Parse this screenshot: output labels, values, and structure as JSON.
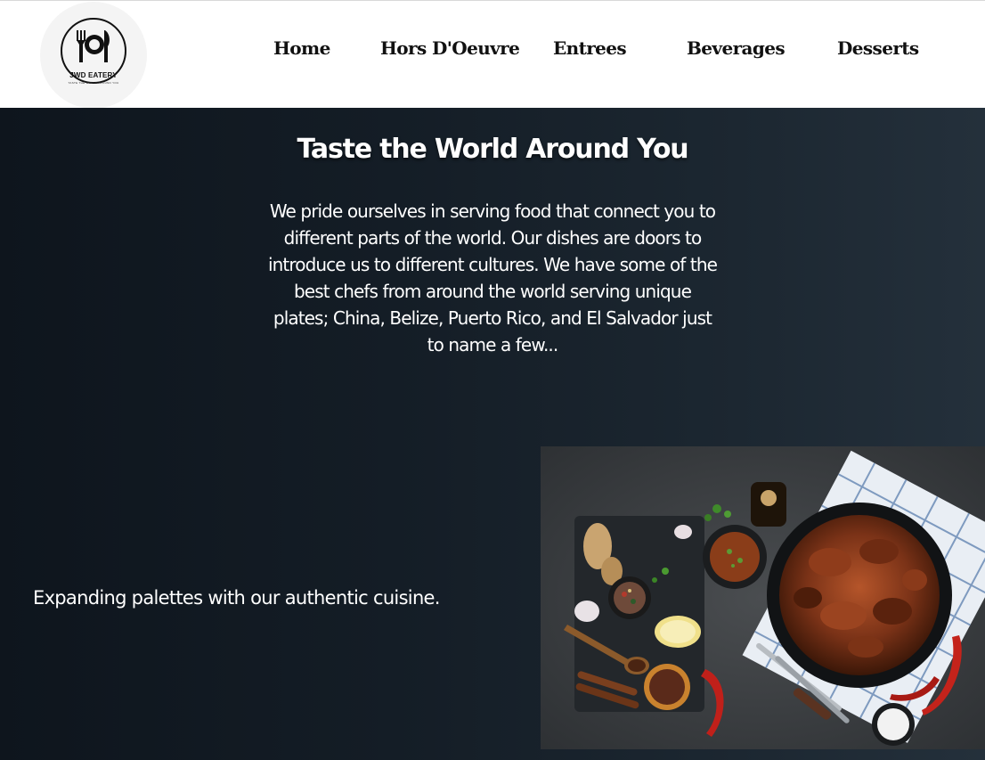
{
  "header": {
    "logo": {
      "name": "JWD EATERY",
      "tagline": "TASTE THE WORLD AROUND YOU",
      "icon": "plate-utensils-icon"
    },
    "nav": [
      {
        "label": "Home"
      },
      {
        "label": "Hors D'Oeuvre"
      },
      {
        "label": "Entrees"
      },
      {
        "label": "Beverages"
      },
      {
        "label": "Desserts"
      }
    ]
  },
  "hero": {
    "title": "Taste the World Around You",
    "lines": [
      "We pride ourselves in serving food that connect you to",
      "different parts of the world. Our dishes are doors to",
      "introduce us to different cultures. We have some of the",
      "best chefs from around the world serving unique",
      "plates; China, Belize, Puerto Rico, and El Salvador just",
      "to name a few..."
    ]
  },
  "feature": {
    "tagline": "Expanding palettes with our authentic cuisine.",
    "image": "grilled-chicken-spices-photo"
  },
  "colors": {
    "header_bg": "#ffffff",
    "main_bg_dark": "#0e151d",
    "main_bg_light": "#24303b",
    "text_light": "#ffffff",
    "nav_text": "#111111"
  }
}
